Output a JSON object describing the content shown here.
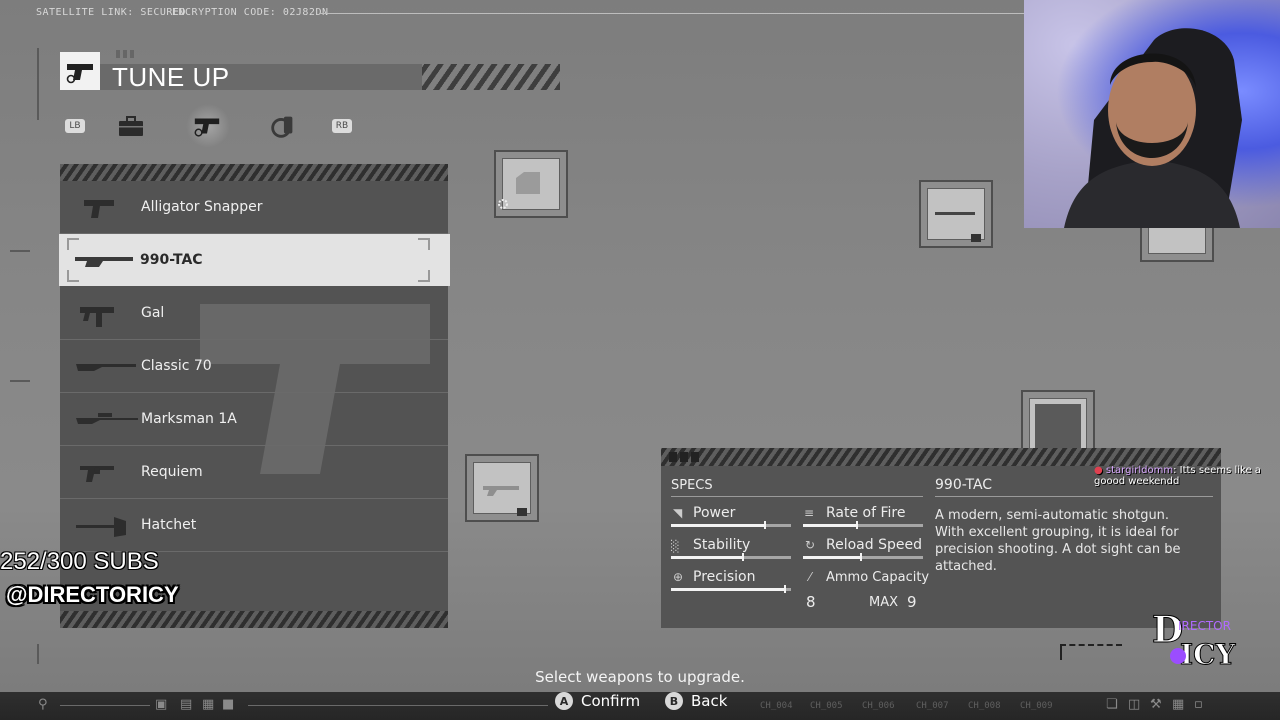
{
  "topbar": {
    "satellite": "SATELLITE LINK: SECURED",
    "encryption": "ENCRYPTION CODE: 02J82DN"
  },
  "menu": {
    "title": "TUNE UP",
    "tabs": [
      {
        "icon": "lb-button",
        "label": "LB"
      },
      {
        "icon": "briefcase-icon"
      },
      {
        "icon": "handgun-icon"
      },
      {
        "icon": "grenade-icon"
      },
      {
        "icon": "rb-button",
        "label": "RB"
      }
    ],
    "active_tab": 2
  },
  "weapons": [
    {
      "name": "Alligator Snapper",
      "icon": "pistol-icon"
    },
    {
      "name": "990-TAC",
      "icon": "shotgun-icon",
      "selected": true
    },
    {
      "name": "Gal",
      "icon": "smg-icon"
    },
    {
      "name": "Classic 70",
      "icon": "rifle-icon"
    },
    {
      "name": "Marksman 1A",
      "icon": "sniper-icon"
    },
    {
      "name": "Requiem",
      "icon": "revolver-icon"
    },
    {
      "name": "Hatchet",
      "icon": "hatchet-icon"
    }
  ],
  "specs": {
    "header": "SPECS",
    "weapon_name": "990-TAC",
    "description": "A modern, semi-automatic shotgun. With excellent grouping, it is ideal for precision shooting. A dot sight can be attached.",
    "stats": [
      {
        "label": "Power",
        "value": 0.78
      },
      {
        "label": "Rate of Fire",
        "value": 0.45
      },
      {
        "label": "Stability",
        "value": 0.6
      },
      {
        "label": "Reload Speed",
        "value": 0.48
      },
      {
        "label": "Precision",
        "value": 0.95
      }
    ],
    "ammo_label": "Ammo Capacity",
    "ammo_current": "8",
    "ammo_max_label": "MAX",
    "ammo_max": "9"
  },
  "overlay": {
    "subs": "252/300 SUBS",
    "handle": "@DIRECTORICY",
    "logo_text": "DIRECTOR ICY"
  },
  "chat": {
    "user": "stargirldomm",
    "message": ": Itts seems like a goood weekendd"
  },
  "footer": {
    "hint": "Select weapons to upgrade.",
    "confirm_key": "A",
    "confirm_label": "Confirm",
    "back_key": "B",
    "back_label": "Back",
    "channels": [
      "CH_004",
      "CH_005",
      "CH_006",
      "CH_007",
      "CH_008",
      "CH_009"
    ]
  },
  "colors": {
    "background": "#878787",
    "panel": "#535353",
    "selected_row": "#e3e3e3",
    "chat_user": "#d9a8ff"
  }
}
